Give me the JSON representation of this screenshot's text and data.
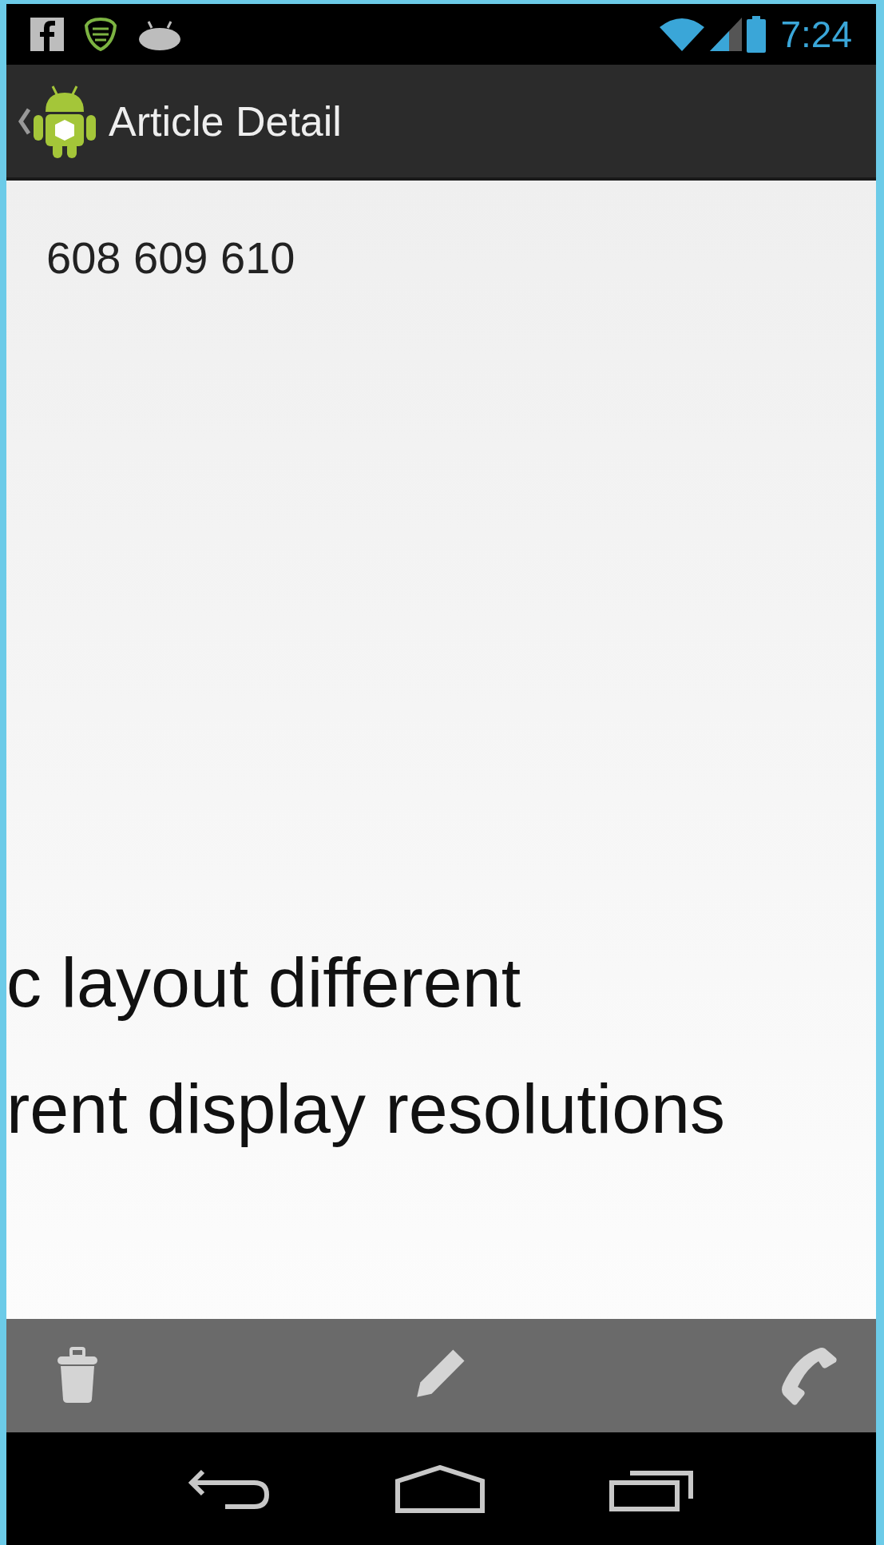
{
  "status_bar": {
    "time": "7:24"
  },
  "action_bar": {
    "title": "Article Detail"
  },
  "content": {
    "text": "608 609 610"
  },
  "overlay_lines": [
    "c layout different",
    "rent display resolutions"
  ],
  "bottom_actions": [
    {
      "kind": "delete"
    },
    {
      "kind": "edit"
    },
    {
      "kind": "call"
    }
  ],
  "nav_bar": [
    {
      "kind": "back"
    },
    {
      "kind": "home"
    },
    {
      "kind": "recents"
    }
  ]
}
